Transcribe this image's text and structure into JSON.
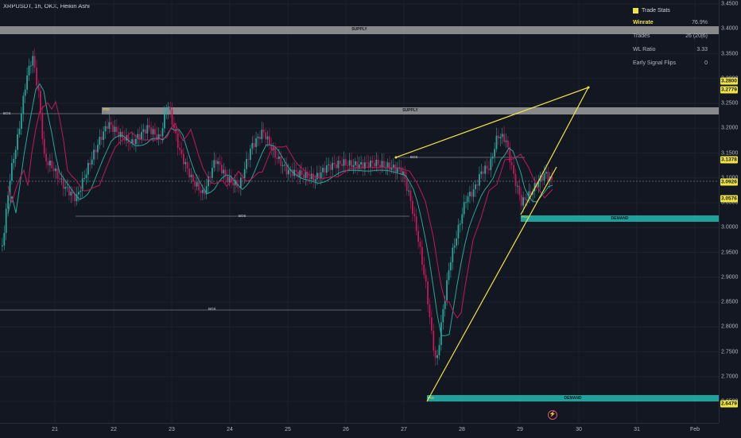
{
  "header": {
    "symbol": "XRPUSDT, 1h, OKX, Heikin Ashi"
  },
  "stats": {
    "title": "Trade Stats",
    "rows": [
      {
        "label": "Winrate",
        "value": "76.9%",
        "accent": true
      },
      {
        "label": "Trades",
        "value": "26 (20|6)"
      },
      {
        "label": "WL Ratio",
        "value": "3.33"
      },
      {
        "label": "Early Signal Flips",
        "value": "0"
      }
    ]
  },
  "zones": {
    "supply_top": "SUPPLY",
    "supply_mid": "SUPPLY",
    "demand_right": "DEMAND",
    "demand_bottom": "DEMAND",
    "bos_labels": [
      "BOS",
      "BOS",
      "BOS",
      "BOS"
    ],
    "poi_labels": [
      "POI",
      "POI",
      "POI"
    ]
  },
  "y_axis": {
    "ticks": [
      "3.4500",
      "3.4000",
      "3.3500",
      "3.3000",
      "3.2500",
      "3.2000",
      "3.1500",
      "3.1000",
      "3.0500",
      "3.0000",
      "2.9500",
      "2.9000",
      "2.8500",
      "2.8000",
      "2.7500",
      "2.7000",
      "2.6500"
    ],
    "price_labels": [
      {
        "text": "3.2800",
        "color": "#f0e442"
      },
      {
        "text": "3.2779",
        "color": "#f0e442"
      },
      {
        "text": "3.1378",
        "color": "#f0e442"
      },
      {
        "text": "3.0926",
        "color": "#f0e442"
      },
      {
        "text": "3.0576",
        "color": "#f0e442"
      },
      {
        "text": "2.6479",
        "color": "#f0e442"
      }
    ]
  },
  "x_axis": {
    "ticks": [
      "21",
      "22",
      "23",
      "24",
      "25",
      "26",
      "27",
      "28",
      "29",
      "30",
      "31",
      "Feb"
    ]
  },
  "colors": {
    "background": "#131722",
    "bull": "#26a69a",
    "bear": "#c2185b",
    "supply_zone": "#9e9e9e",
    "demand_zone": "#20b2aa",
    "triangle": "#f0e442"
  },
  "icons": {
    "checkbox": "checkbox-icon",
    "bolt": "lightning-icon"
  }
}
